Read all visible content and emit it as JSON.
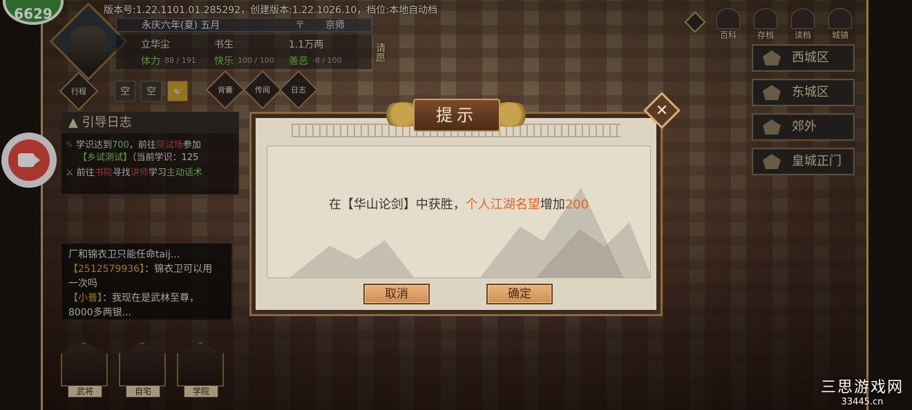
{
  "version_line": "版本号:1.22.1101.01.285292，创建版本:1.22.1026.10，档位:本地自动档",
  "top_badge": "6629",
  "player": {
    "date": "永庆六年(夏) 五月",
    "city": "京师",
    "name": "立华尘",
    "title": "书生",
    "money": "1.1万两",
    "stamina_label": "体力",
    "stamina_value": "88 / 191",
    "happy_label": "快乐",
    "happy_value": "100 / 100",
    "karma_label": "善恶",
    "karma_value": "-8 / 100"
  },
  "left_buttons": {
    "schedule": "行程",
    "slot1": "空",
    "slot2": "空",
    "backpack": "背囊",
    "news": "传闻",
    "diary": "日志",
    "side_tag": "请愿"
  },
  "guide": {
    "title": "引导日志",
    "row1_a": "学识达到",
    "row1_num": "700",
    "row1_b": "，前往",
    "row1_place": "院试场",
    "row1_c": "参加",
    "row2_exam": "【乡试测试】",
    "row2_b": "（当前学识：125",
    "row3_a": "前往",
    "row3_place": "书院",
    "row3_b": "寻找",
    "row3_npc": "讲师",
    "row3_c": "学习",
    "row3_skill": "主动话术"
  },
  "chat": {
    "line1": "厂和锦衣卫只能任命taij...",
    "line2_id": "【2512579936】",
    "line2_text": "：锦衣卫可以用",
    "line3": "一次吗",
    "line4_id": "【小普】",
    "line4_text": "：我现在是武林至尊，",
    "line5": "8000多两银..."
  },
  "buildings": [
    "武将",
    "自宅",
    "学院"
  ],
  "top_icons": [
    "百科",
    "存档",
    "读档",
    "城镇"
  ],
  "districts": [
    "西城区",
    "东城区",
    "郊外",
    "皇城正门"
  ],
  "dialog": {
    "title": "提示",
    "msg_a": "在【华山论剑】中获胜，",
    "msg_hl": "个人江湖名望",
    "msg_b": "增加",
    "msg_num": "200",
    "cancel": "取消",
    "confirm": "确定",
    "close_icon": "close-icon"
  },
  "watermark": {
    "name": "三思游戏网",
    "url": "33445.cn"
  }
}
